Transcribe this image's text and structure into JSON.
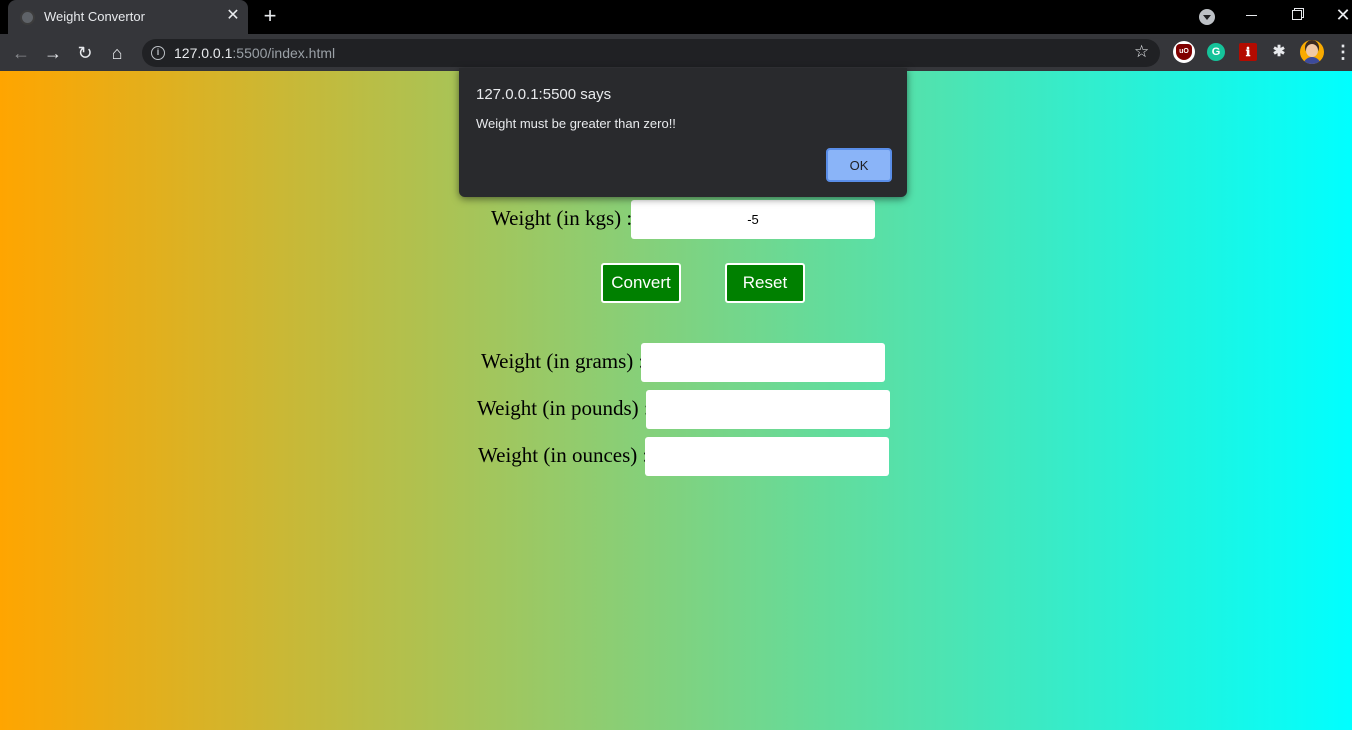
{
  "browser": {
    "tab_title": "Weight Convertor",
    "tab_close": "✕",
    "new_tab": "+",
    "url_host": "127.0.0.1",
    "url_path": ":5500/index.html"
  },
  "form": {
    "kgs_label": "Weight (in kgs) :",
    "kgs_value": "-5",
    "convert_label": "Convert",
    "reset_label": "Reset",
    "grams_label": "Weight (in grams) :",
    "grams_value": "",
    "pounds_label": "Weight (in pounds) :",
    "pounds_value": "",
    "ounces_label": "Weight (in ounces) :",
    "ounces_value": ""
  },
  "alert": {
    "title": "127.0.0.1:5500 says",
    "message": "Weight must be greater than zero!!",
    "ok_label": "OK"
  },
  "colors": {
    "gradient_start": "#ffa500",
    "gradient_end": "#00ffff",
    "button_bg": "#008000",
    "dialog_bg": "#292a2d",
    "ok_button_bg": "#8ab4f8"
  }
}
